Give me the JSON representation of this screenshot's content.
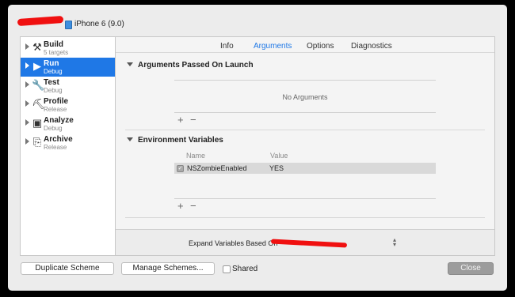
{
  "header": {
    "device_label": "iPhone 6 (9.0)",
    "redaction_color": "#f01010"
  },
  "sidebar": {
    "items": [
      {
        "name": "Build",
        "sub": "5 targets",
        "icon": "hammer-icon",
        "selected": false
      },
      {
        "name": "Run",
        "sub": "Debug",
        "icon": "play-icon",
        "selected": true
      },
      {
        "name": "Test",
        "sub": "Debug",
        "icon": "wrench-icon",
        "selected": false
      },
      {
        "name": "Profile",
        "sub": "Release",
        "icon": "instruments-icon",
        "selected": false
      },
      {
        "name": "Analyze",
        "sub": "Debug",
        "icon": "analyze-icon",
        "selected": false
      },
      {
        "name": "Archive",
        "sub": "Release",
        "icon": "archive-icon",
        "selected": false
      }
    ],
    "selection_color": "#1f78e6"
  },
  "tabs": [
    {
      "label": "Info",
      "active": false
    },
    {
      "label": "Arguments",
      "active": true
    },
    {
      "label": "Options",
      "active": false
    },
    {
      "label": "Diagnostics",
      "active": false
    }
  ],
  "arguments": {
    "title": "Arguments Passed On Launch",
    "empty_text": "No Arguments",
    "add_label": "+",
    "remove_label": "−"
  },
  "environment": {
    "title": "Environment Variables",
    "col_name": "Name",
    "col_value": "Value",
    "rows": [
      {
        "name": "NSZombieEnabled",
        "value": "YES",
        "enabled": true
      }
    ],
    "add_label": "+",
    "remove_label": "−"
  },
  "expand": {
    "label": "Expand Variables Based On"
  },
  "footer": {
    "duplicate_label": "Duplicate Scheme",
    "manage_label": "Manage Schemes...",
    "shared_label": "Shared",
    "shared_checked": false,
    "close_label": "Close"
  }
}
